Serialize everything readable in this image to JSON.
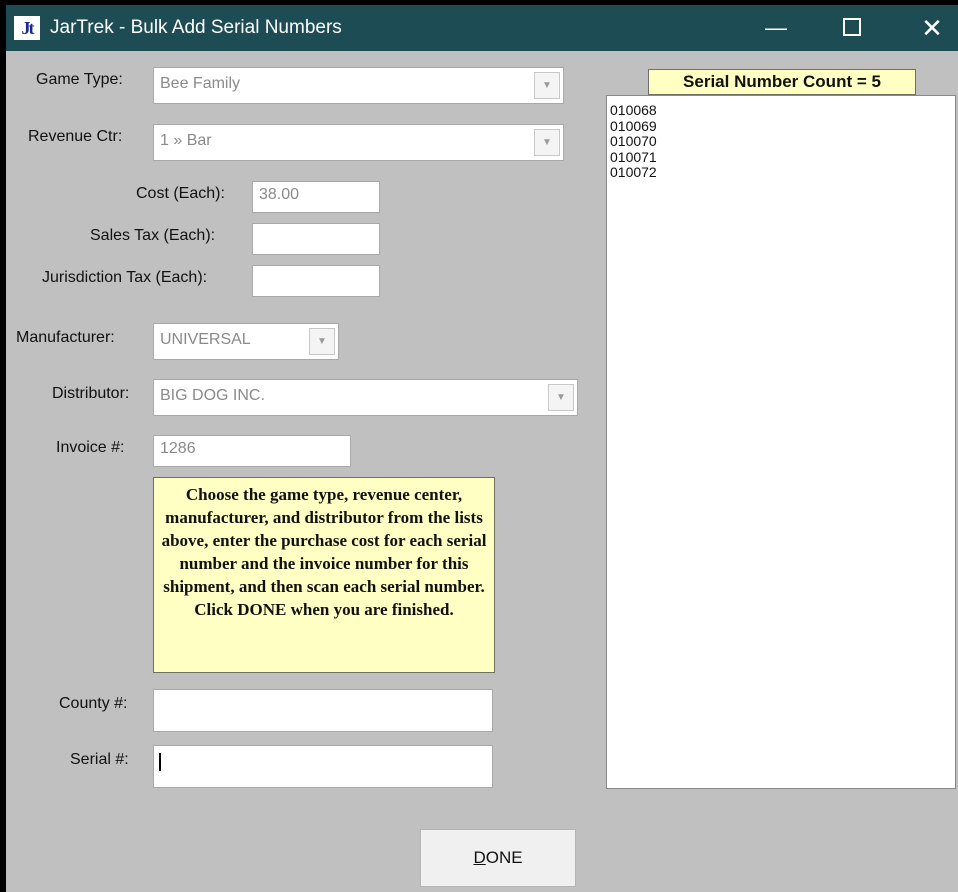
{
  "window": {
    "app_icon": "Jt",
    "title": "JarTrek - Bulk Add Serial Numbers",
    "minimize": "—",
    "close": "✕"
  },
  "form": {
    "game_type": {
      "label": "Game Type:",
      "value": "Bee Family"
    },
    "revenue_ctr": {
      "label": "Revenue Ctr:",
      "value": "1 » Bar"
    },
    "cost_each": {
      "label": "Cost (Each):",
      "value": "38.00"
    },
    "sales_tax_each": {
      "label": "Sales Tax (Each):",
      "value": ""
    },
    "jurisdiction_tax_each": {
      "label": "Jurisdiction Tax (Each):",
      "value": ""
    },
    "manufacturer": {
      "label": "Manufacturer:",
      "value": "UNIVERSAL"
    },
    "distributor": {
      "label": "Distributor:",
      "value": "BIG DOG INC."
    },
    "invoice": {
      "label": "Invoice #:",
      "value": "1286"
    },
    "county": {
      "label": "County #:",
      "value": ""
    },
    "serial": {
      "label": "Serial #:",
      "value": ""
    }
  },
  "instructions": "Choose the game type, revenue center, manufacturer, and distributor from the lists above, enter the purchase cost for each serial number and the invoice number for this shipment, and then scan each serial number. Click DONE when you are finished.",
  "serial_count_label": "Serial Number Count = 5",
  "serial_numbers": [
    "010068",
    "010069",
    "010070",
    "010071",
    "010072"
  ],
  "done_button": {
    "mnemonic": "D",
    "rest": "ONE"
  },
  "colors": {
    "titlebar": "#1e4c55",
    "window_bg": "#c0c0c0",
    "note_bg": "#ffffc4"
  },
  "icons": {
    "dropdown": "chevron-down-icon",
    "maximize": "maximize-icon"
  }
}
